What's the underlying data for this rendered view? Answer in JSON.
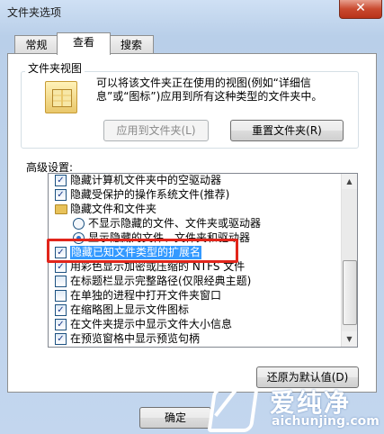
{
  "window": {
    "title": "文件夹选项",
    "close_symbol": "✕"
  },
  "tabs": [
    {
      "label": "常规"
    },
    {
      "label": "查看",
      "active": true
    },
    {
      "label": "搜索"
    }
  ],
  "folder_view": {
    "legend": "文件夹视图",
    "description": "可以将该文件夹正在使用的视图(例如“详细信息”或“图标”)应用到所有这种类型的文件夹中。",
    "apply_button": "应用到文件夹(L)",
    "reset_button": "重置文件夹(R)"
  },
  "advanced": {
    "label": "高级设置:",
    "items": [
      {
        "kind": "checkbox",
        "checked": true,
        "text": "隐藏计算机文件夹中的空驱动器"
      },
      {
        "kind": "checkbox",
        "checked": true,
        "text": "隐藏受保护的操作系统文件(推荐)"
      },
      {
        "kind": "folder",
        "text": "隐藏文件和文件夹"
      },
      {
        "kind": "radio",
        "checked": false,
        "text": "不显示隐藏的文件、文件夹或驱动器"
      },
      {
        "kind": "radio",
        "checked": true,
        "text": "显示隐藏的文件、文件夹和驱动器"
      },
      {
        "kind": "checkbox",
        "checked": true,
        "highlight": true,
        "text": "隐藏已知文件类型的扩展名"
      },
      {
        "kind": "checkbox",
        "checked": true,
        "text": "用彩色显示加密或压缩的 NTFS 文件"
      },
      {
        "kind": "checkbox",
        "checked": false,
        "text": "在标题栏显示完整路径(仅限经典主题)"
      },
      {
        "kind": "checkbox",
        "checked": false,
        "text": "在单独的进程中打开文件夹窗口"
      },
      {
        "kind": "checkbox",
        "checked": true,
        "text": "在缩略图上显示文件图标"
      },
      {
        "kind": "checkbox",
        "checked": true,
        "text": "在文件夹提示中显示文件大小信息"
      },
      {
        "kind": "checkbox",
        "checked": true,
        "text": "在预览窗格中显示预览句柄"
      }
    ],
    "restore_button": "还原为默认值(D)"
  },
  "footer": {
    "ok_button": "确定"
  },
  "watermark": {
    "cn": "爱纯净",
    "en": "aichunjing.com"
  },
  "colors": {
    "highlight": "#3399ff",
    "red_box": "#e1251b"
  }
}
